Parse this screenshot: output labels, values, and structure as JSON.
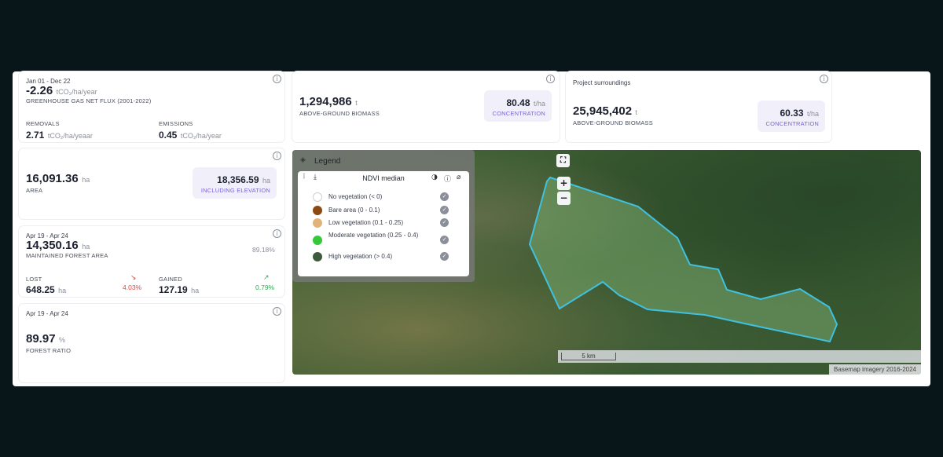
{
  "flux": {
    "date_range": "Jan 01 - Dec 22",
    "value": "-2.26",
    "unit": "tCO₂/ha/year",
    "label": "GREENHOUSE GAS NET FLUX (2001-2022)",
    "removals_label": "REMOVALS",
    "removals_value": "2.71",
    "removals_unit": "tCO₂/ha/yeaar",
    "emissions_label": "EMISSIONS",
    "emissions_value": "0.45",
    "emissions_unit": "tCO₂/ha/year"
  },
  "area": {
    "value": "16,091.36",
    "unit": "ha",
    "label": "AREA",
    "elev_value": "18,356.59",
    "elev_unit": "ha",
    "elev_label": "INCLUDING ELEVATION"
  },
  "forest": {
    "date_range": "Apr 19 - Apr 24",
    "value": "14,350.16",
    "unit": "ha",
    "label": "MAINTAINED FOREST AREA",
    "pct": "89.18%",
    "lost_label": "LOST",
    "lost_value": "648.25",
    "lost_unit": "ha",
    "lost_pct": "4.03%",
    "gained_label": "GAINED",
    "gained_value": "127.19",
    "gained_unit": "ha",
    "gained_pct": "0.79%"
  },
  "ratio": {
    "date_range": "Apr 19 - Apr 24",
    "value": "89.97",
    "unit": "%",
    "label": "FOREST RATIO"
  },
  "biomass": {
    "value": "1,294,986",
    "unit": "t",
    "label": "ABOVE-GROUND BIOMASS",
    "conc_value": "80.48",
    "conc_unit": "t/ha",
    "conc_label": "CONCENTRATION"
  },
  "surroundings": {
    "title": "Project surroundings",
    "value": "25,945,402",
    "unit": "t",
    "label": "ABOVE-GROUND BIOMASS",
    "conc_value": "60.33",
    "conc_unit": "t/ha",
    "conc_label": "CONCENTRATION"
  },
  "legend": {
    "title": "Legend",
    "layer_title": "NDVI median",
    "items": [
      {
        "label": "No vegetation (< 0)",
        "color": "#ffffff"
      },
      {
        "label": "Bare area (0 - 0.1)",
        "color": "#8b4a12"
      },
      {
        "label": "Low vegetation (0.1 - 0.25)",
        "color": "#e2b27a"
      },
      {
        "label": "Moderate vegetation (0.25 - 0.4)",
        "color": "#35c93a"
      },
      {
        "label": "High vegetation (> 0.4)",
        "color": "#3d5a3a"
      }
    ]
  },
  "map": {
    "zoom_in": "+",
    "zoom_out": "−",
    "scale": "5 km",
    "attribution": "Basemap imagery 2016-2024",
    "polygon_color": "#3fc2e0"
  },
  "colors": {
    "accent": "#7b63d6",
    "loss": "#e8423c",
    "gain": "#2fa84f"
  }
}
